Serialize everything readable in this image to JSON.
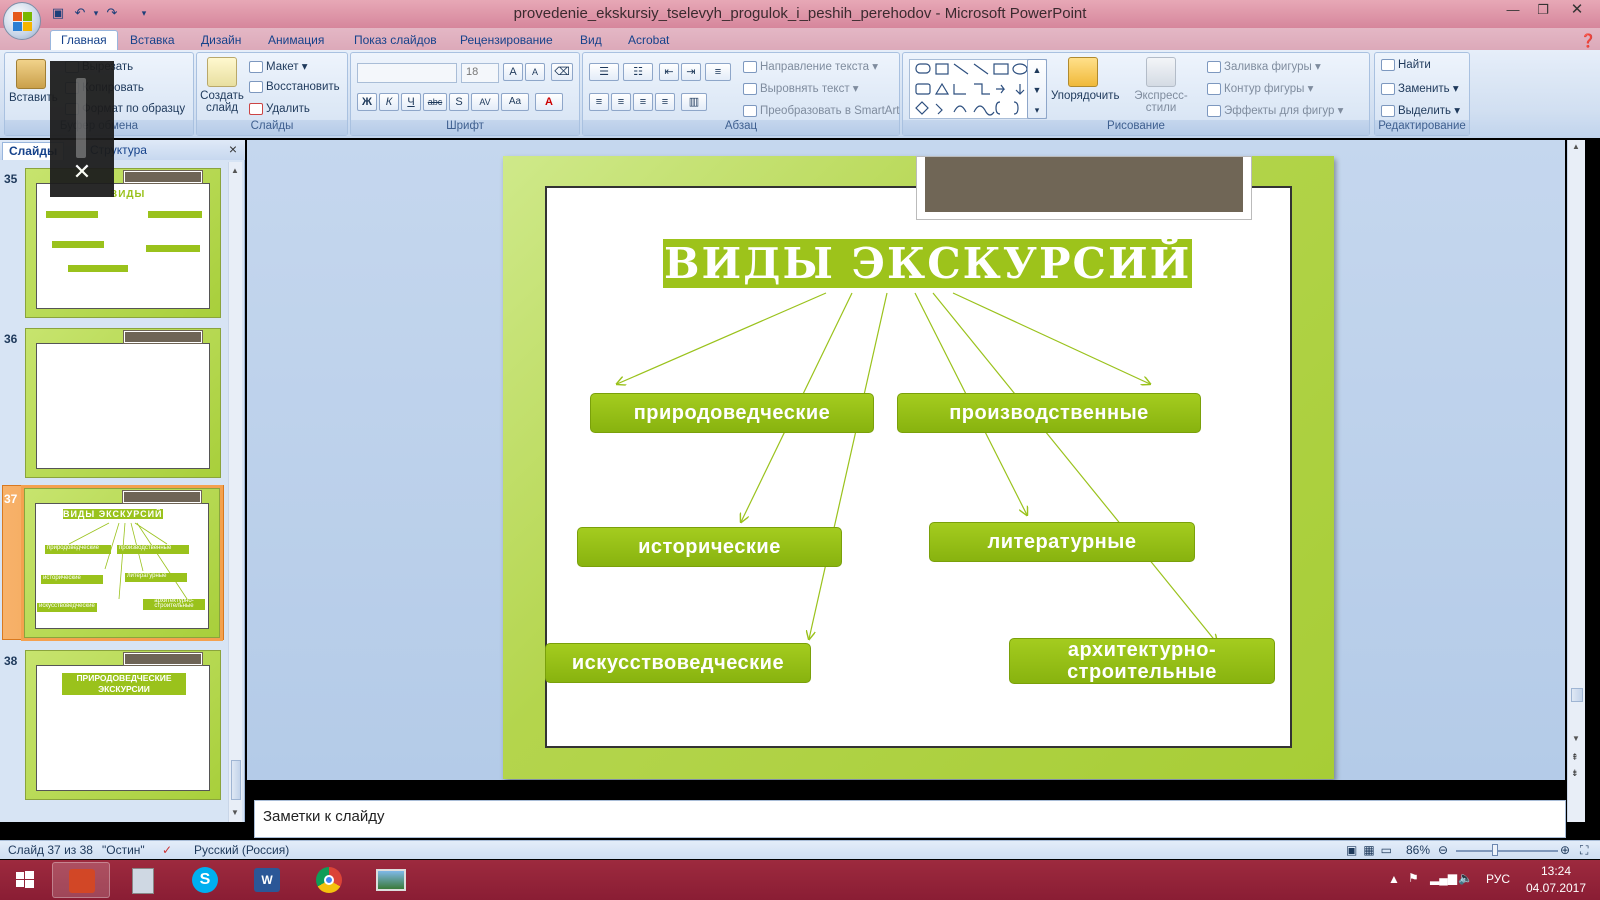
{
  "window": {
    "title": "provedenie_ekskursiy_tselevyh_progulok_i_peshih_perehodov - Microsoft PowerPoint"
  },
  "tabs": [
    "Главная",
    "Вставка",
    "Дизайн",
    "Анимация",
    "Показ слайдов",
    "Рецензирование",
    "Вид",
    "Acrobat"
  ],
  "ribbon": {
    "clipboard": {
      "paste": "Вставить",
      "cut": "Вырезать",
      "copy": "Копировать",
      "format": "Формат по образцу",
      "label": "Буфер обмена"
    },
    "slides": {
      "new_slide": "Создать слайд",
      "layout": "Макет",
      "reset": "Восстановить",
      "delete": "Удалить",
      "label": "Слайды"
    },
    "font": {
      "size": "18",
      "label": "Шрифт"
    },
    "paragraph": {
      "text_direction": "Направление текста",
      "align_text": "Выровнять текст",
      "smartart": "Преобразовать в SmartArt",
      "label": "Абзац"
    },
    "drawing": {
      "arrange": "Упорядочить",
      "quick_styles": "Экспресс-стили",
      "shape_fill": "Заливка фигуры",
      "shape_outline": "Контур фигуры",
      "shape_effects": "Эффекты для фигур",
      "label": "Рисование"
    },
    "editing": {
      "find": "Найти",
      "replace": "Заменить",
      "select": "Выделить",
      "label": "Редактирование"
    }
  },
  "panel": {
    "tab_slides": "Слайды",
    "tab_outline": "Структура"
  },
  "thumbnails": [
    {
      "num": "35",
      "title": "ВИДЫ"
    },
    {
      "num": "36"
    },
    {
      "num": "37",
      "title": "ВИДЫ ЭКСКУРСИЙ",
      "items": [
        "природоведческие",
        "производственные",
        "исторические",
        "литературные",
        "искусствоведческие",
        "архитектурно-строительные"
      ]
    },
    {
      "num": "38",
      "title": "ПРИРОДОВЕДЧЕСКИЕ ЭКСКУРСИИ"
    }
  ],
  "slide": {
    "title": "ВИДЫ ЭКСКУРСИЙ",
    "boxes": {
      "b1": "природоведческие",
      "b2": "производственные",
      "b3": "исторические",
      "b4": "литературные",
      "b5": "искусствоведческие",
      "b6": "архитектурно-строительные"
    }
  },
  "notes": {
    "placeholder": "Заметки к слайду"
  },
  "status": {
    "slide": "Слайд 37 из 38",
    "theme": "\"Остин\"",
    "language": "Русский (Россия)",
    "zoom": "86%"
  },
  "tray": {
    "lang": "РУС",
    "time": "13:24",
    "date": "04.07.2017"
  },
  "colors": {
    "accent_green": "#9dc31b",
    "tab_dark": "#706656",
    "title_bar": "#d6869c",
    "taskbar": "#8a1d34"
  }
}
